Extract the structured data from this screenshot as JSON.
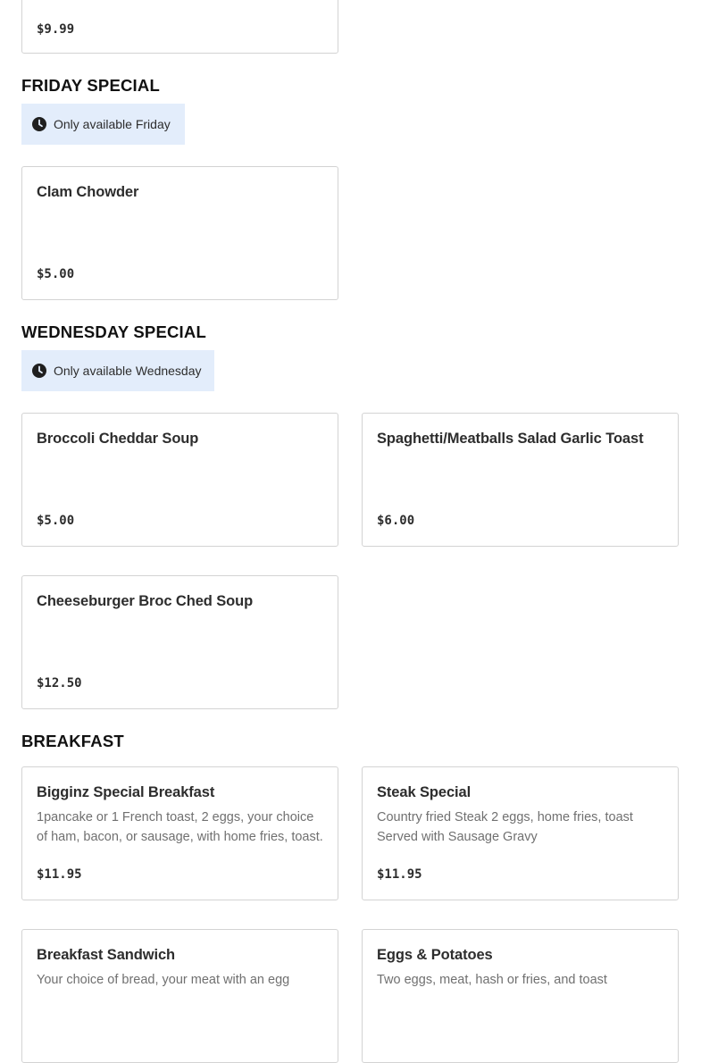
{
  "top_card": {
    "price": "$9.99"
  },
  "friday": {
    "title": "FRIDAY SPECIAL",
    "availability": "Only available Friday",
    "items": [
      {
        "name": "Clam Chowder",
        "description": "",
        "price": "$5.00"
      }
    ]
  },
  "wednesday": {
    "title": "WEDNESDAY SPECIAL",
    "availability": "Only available Wednesday",
    "items": [
      {
        "name": "Broccoli Cheddar Soup",
        "description": "",
        "price": "$5.00"
      },
      {
        "name": "Spaghetti/Meatballs Salad Garlic Toast",
        "description": "",
        "price": "$6.00"
      },
      {
        "name": "Cheeseburger Broc Ched Soup",
        "description": "",
        "price": "$12.50"
      }
    ]
  },
  "breakfast": {
    "title": "BREAKFAST",
    "items": [
      {
        "name": "Bigginz Special Breakfast",
        "description": "1pancake or 1 French toast, 2 eggs, your choice of ham, bacon, or sausage, with home fries, toast.",
        "price": "$11.95"
      },
      {
        "name": "Steak Special",
        "description": "Country fried Steak 2 eggs, home fries, toast Served with Sausage Gravy",
        "price": "$11.95"
      },
      {
        "name": "Breakfast Sandwich",
        "description": "Your choice of bread, your meat with an egg",
        "price": ""
      },
      {
        "name": "Eggs & Potatoes",
        "description": "Two eggs, meat, hash or fries, and toast",
        "price": ""
      }
    ]
  },
  "icons": {
    "clock": "clock-icon"
  }
}
